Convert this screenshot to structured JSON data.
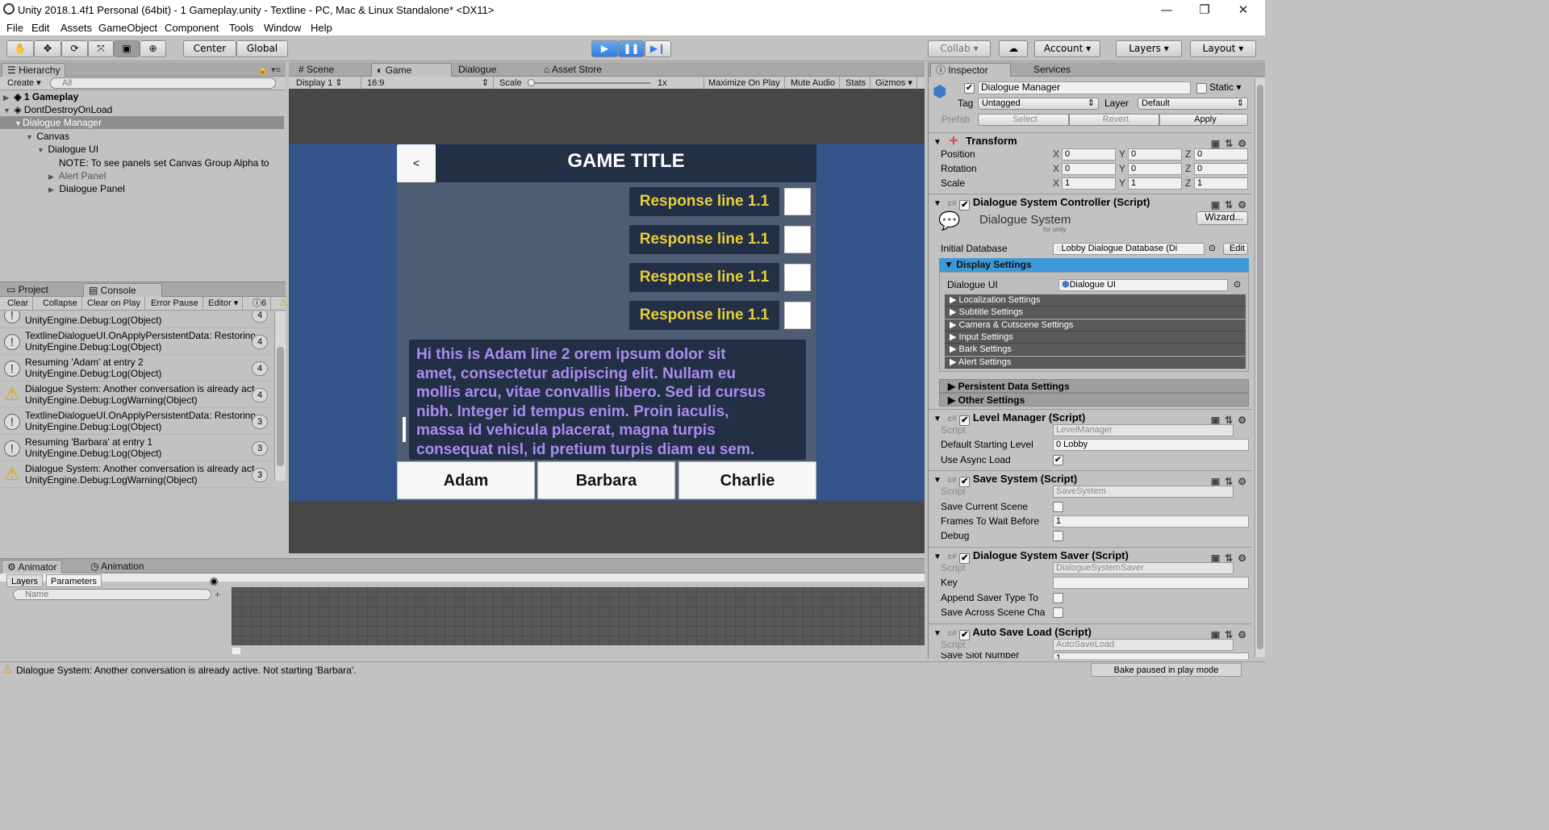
{
  "window": {
    "title": "Unity 2018.1.4f1 Personal (64bit) - 1 Gameplay.unity - Textline - PC, Mac & Linux Standalone* <DX11>",
    "minimize": "—",
    "restore": "❐",
    "close": "✕"
  },
  "menu": [
    "File",
    "Edit",
    "Assets",
    "GameObject",
    "Component",
    "Tools",
    "Window",
    "Help"
  ],
  "toolbar": {
    "center": "Center",
    "global": "Global",
    "collab": "Collab",
    "account": "Account",
    "layers": "Layers",
    "layout": "Layout"
  },
  "hierarchy": {
    "tab": "Hierarchy",
    "create": "Create",
    "search_placeholder": "All",
    "items": [
      {
        "label": "1 Gameplay"
      },
      {
        "label": "DontDestroyOnLoad"
      },
      {
        "label": "Dialogue Manager"
      },
      {
        "label": "Canvas"
      },
      {
        "label": "Dialogue UI"
      },
      {
        "label": "NOTE: To see panels set Canvas Group Alpha to"
      },
      {
        "label": "Alert Panel"
      },
      {
        "label": "Dialogue Panel"
      }
    ]
  },
  "console": {
    "tabs": [
      "Project",
      "Console"
    ],
    "buttons": [
      "Clear",
      "Collapse",
      "Clear on Play",
      "Error Pause",
      "Editor"
    ],
    "info_count": "6",
    "top_partial": "UnityEngine.Debug:Log(Object)",
    "top_partial_count": "4",
    "entries": [
      {
        "line1": "TextlineDialogueUI.OnApplyPersistentData: Restoring",
        "line2": "UnityEngine.Debug:Log(Object)",
        "count": "4",
        "type": "info"
      },
      {
        "line1": "Resuming 'Adam' at entry 2",
        "line2": "UnityEngine.Debug:Log(Object)",
        "count": "4",
        "type": "info"
      },
      {
        "line1": "Dialogue System: Another conversation is already active",
        "line2": "UnityEngine.Debug:LogWarning(Object)",
        "count": "4",
        "type": "warn"
      },
      {
        "line1": "TextlineDialogueUI.OnApplyPersistentData: Restoring",
        "line2": "UnityEngine.Debug:Log(Object)",
        "count": "3",
        "type": "info"
      },
      {
        "line1": "Resuming 'Barbara' at entry 1",
        "line2": "UnityEngine.Debug:Log(Object)",
        "count": "3",
        "type": "info"
      },
      {
        "line1": "Dialogue System: Another conversation is already active",
        "line2": "UnityEngine.Debug:LogWarning(Object)",
        "count": "3",
        "type": "warn"
      }
    ]
  },
  "animator": {
    "tabs": [
      "Animator",
      "Animation"
    ],
    "subtabs": [
      "Layers",
      "Parameters"
    ],
    "search_placeholder": "Name"
  },
  "center_tabs": [
    "Scene",
    "Game",
    "Dialogue",
    "Asset Store"
  ],
  "game_bar": {
    "display": "Display 1",
    "aspect": "16:9",
    "scale_label": "Scale",
    "scale_value": "1x",
    "buttons": [
      "Maximize On Play",
      "Mute Audio",
      "Stats",
      "Gizmos"
    ]
  },
  "game": {
    "back": "<",
    "title": "GAME TITLE",
    "responses": [
      "Response line 1.1",
      "Response line 1.1",
      "Response line 1.1",
      "Response line 1.1"
    ],
    "dialogue_lines": [
      "Hi this is Adam line 2 orem ipsum dolor sit",
      "amet, consectetur adipiscing elit. Nullam eu",
      "mollis arcu, vitae convallis libero. Sed id cursus",
      "nibh. Integer id tempus enim. Proin iaculis,",
      "massa id vehicula placerat, magna turpis",
      "consequat nisl, id pretium turpis diam eu sem."
    ],
    "characters": [
      "Adam",
      "Barbara",
      "Charlie"
    ]
  },
  "inspector": {
    "tabs": [
      "Inspector",
      "Services"
    ],
    "object_name": "Dialogue Manager",
    "static": "Static",
    "tag_label": "Tag",
    "tag_value": "Untagged",
    "layer_label": "Layer",
    "layer_value": "Default",
    "prefab_label": "Prefab",
    "prefab_buttons": [
      "Select",
      "Revert",
      "Apply"
    ],
    "transform": {
      "title": "Transform",
      "rows": [
        {
          "label": "Position",
          "x": "0",
          "y": "0",
          "z": "0"
        },
        {
          "label": "Rotation",
          "x": "0",
          "y": "0",
          "z": "0"
        },
        {
          "label": "Scale",
          "x": "1",
          "y": "1",
          "z": "1"
        }
      ]
    },
    "dsc": {
      "title": "Dialogue System Controller (Script)",
      "logo_main": "Dialogue System",
      "logo_sub": "for unity",
      "wizard": "Wizard...",
      "initial_db_label": "Initial Database",
      "initial_db_value": "Lobby Dialogue Database (Di",
      "edit": "Edit",
      "display_settings": "Display Settings",
      "dialogue_ui_label": "Dialogue UI",
      "dialogue_ui_value": "Dialogue UI",
      "sub_sections": [
        "Localization Settings",
        "Subtitle Settings",
        "Camera & Cutscene Settings",
        "Input Settings",
        "Bark Settings",
        "Alert Settings"
      ],
      "persistent": "Persistent Data Settings",
      "other": "Other Settings"
    },
    "level_manager": {
      "title": "Level Manager (Script)",
      "script_label": "Script",
      "script_value": "LevelManager",
      "default_level_label": "Default Starting Level",
      "default_level_value": "0 Lobby",
      "async_label": "Use Async Load"
    },
    "save_system": {
      "title": "Save System (Script)",
      "script_label": "Script",
      "script_value": "SaveSystem",
      "save_scene_label": "Save Current Scene",
      "frames_label": "Frames To Wait Before",
      "frames_value": "1",
      "debug_label": "Debug"
    },
    "saver": {
      "title": "Dialogue System Saver (Script)",
      "script_label": "Script",
      "script_value": "DialogueSystemSaver",
      "key_label": "Key",
      "append_label": "Append Saver Type To",
      "across_label": "Save Across Scene Cha"
    },
    "autosave": {
      "title": "Auto Save Load (Script)",
      "script_label": "Script",
      "script_value": "AutoSaveLoad",
      "slot_label": "Save Slot Number",
      "slot_value": "1"
    }
  },
  "status": {
    "message": "Dialogue System: Another conversation is already active. Not starting 'Barbara'.",
    "bake": "Bake paused in play mode"
  },
  "colors": {
    "game_bg": "#355489",
    "panel_dark": "#232f45",
    "response_text": "#e8ce3c",
    "dialogue_text": "#a98cf0",
    "play_blue": "#2f7de0"
  }
}
